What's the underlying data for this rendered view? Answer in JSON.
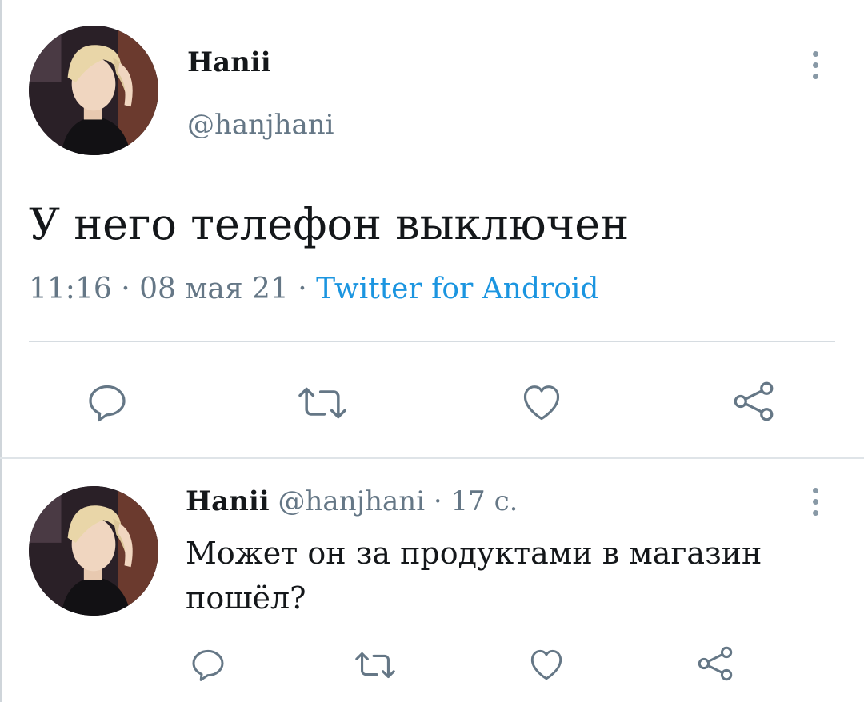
{
  "main_tweet": {
    "author_name": "Hanii",
    "author_handle": "@hanjhani",
    "text": "У него телефон выключен",
    "time": "11:16",
    "date": "08 мая 21",
    "separator": "·",
    "source": "Twitter for Android",
    "actions": [
      "reply-icon",
      "retweet-icon",
      "like-icon",
      "share-icon"
    ]
  },
  "reply_tweet": {
    "author_name": "Hanii",
    "author_handle": "@hanjhani",
    "separator": "·",
    "time_ago": "17 с.",
    "text": "Может он за продуктами в магазин пошёл?",
    "actions": [
      "reply-icon",
      "retweet-icon",
      "like-icon",
      "share-icon"
    ]
  },
  "colors": {
    "text_primary": "#14171a",
    "text_secondary": "#657786",
    "link": "#1b95e0",
    "icon": "#657786",
    "divider": "#d6dce1"
  }
}
